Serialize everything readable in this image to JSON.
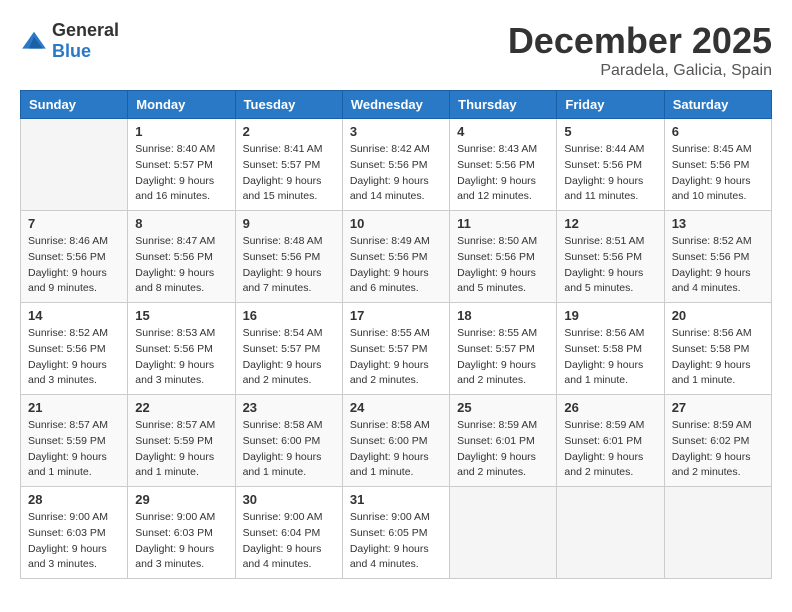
{
  "logo": {
    "general": "General",
    "blue": "Blue"
  },
  "header": {
    "month": "December 2025",
    "location": "Paradela, Galicia, Spain"
  },
  "weekdays": [
    "Sunday",
    "Monday",
    "Tuesday",
    "Wednesday",
    "Thursday",
    "Friday",
    "Saturday"
  ],
  "weeks": [
    [
      {
        "day": "",
        "sunrise": "",
        "sunset": "",
        "daylight": ""
      },
      {
        "day": "1",
        "sunrise": "Sunrise: 8:40 AM",
        "sunset": "Sunset: 5:57 PM",
        "daylight": "Daylight: 9 hours and 16 minutes."
      },
      {
        "day": "2",
        "sunrise": "Sunrise: 8:41 AM",
        "sunset": "Sunset: 5:57 PM",
        "daylight": "Daylight: 9 hours and 15 minutes."
      },
      {
        "day": "3",
        "sunrise": "Sunrise: 8:42 AM",
        "sunset": "Sunset: 5:56 PM",
        "daylight": "Daylight: 9 hours and 14 minutes."
      },
      {
        "day": "4",
        "sunrise": "Sunrise: 8:43 AM",
        "sunset": "Sunset: 5:56 PM",
        "daylight": "Daylight: 9 hours and 12 minutes."
      },
      {
        "day": "5",
        "sunrise": "Sunrise: 8:44 AM",
        "sunset": "Sunset: 5:56 PM",
        "daylight": "Daylight: 9 hours and 11 minutes."
      },
      {
        "day": "6",
        "sunrise": "Sunrise: 8:45 AM",
        "sunset": "Sunset: 5:56 PM",
        "daylight": "Daylight: 9 hours and 10 minutes."
      }
    ],
    [
      {
        "day": "7",
        "sunrise": "Sunrise: 8:46 AM",
        "sunset": "Sunset: 5:56 PM",
        "daylight": "Daylight: 9 hours and 9 minutes."
      },
      {
        "day": "8",
        "sunrise": "Sunrise: 8:47 AM",
        "sunset": "Sunset: 5:56 PM",
        "daylight": "Daylight: 9 hours and 8 minutes."
      },
      {
        "day": "9",
        "sunrise": "Sunrise: 8:48 AM",
        "sunset": "Sunset: 5:56 PM",
        "daylight": "Daylight: 9 hours and 7 minutes."
      },
      {
        "day": "10",
        "sunrise": "Sunrise: 8:49 AM",
        "sunset": "Sunset: 5:56 PM",
        "daylight": "Daylight: 9 hours and 6 minutes."
      },
      {
        "day": "11",
        "sunrise": "Sunrise: 8:50 AM",
        "sunset": "Sunset: 5:56 PM",
        "daylight": "Daylight: 9 hours and 5 minutes."
      },
      {
        "day": "12",
        "sunrise": "Sunrise: 8:51 AM",
        "sunset": "Sunset: 5:56 PM",
        "daylight": "Daylight: 9 hours and 5 minutes."
      },
      {
        "day": "13",
        "sunrise": "Sunrise: 8:52 AM",
        "sunset": "Sunset: 5:56 PM",
        "daylight": "Daylight: 9 hours and 4 minutes."
      }
    ],
    [
      {
        "day": "14",
        "sunrise": "Sunrise: 8:52 AM",
        "sunset": "Sunset: 5:56 PM",
        "daylight": "Daylight: 9 hours and 3 minutes."
      },
      {
        "day": "15",
        "sunrise": "Sunrise: 8:53 AM",
        "sunset": "Sunset: 5:56 PM",
        "daylight": "Daylight: 9 hours and 3 minutes."
      },
      {
        "day": "16",
        "sunrise": "Sunrise: 8:54 AM",
        "sunset": "Sunset: 5:57 PM",
        "daylight": "Daylight: 9 hours and 2 minutes."
      },
      {
        "day": "17",
        "sunrise": "Sunrise: 8:55 AM",
        "sunset": "Sunset: 5:57 PM",
        "daylight": "Daylight: 9 hours and 2 minutes."
      },
      {
        "day": "18",
        "sunrise": "Sunrise: 8:55 AM",
        "sunset": "Sunset: 5:57 PM",
        "daylight": "Daylight: 9 hours and 2 minutes."
      },
      {
        "day": "19",
        "sunrise": "Sunrise: 8:56 AM",
        "sunset": "Sunset: 5:58 PM",
        "daylight": "Daylight: 9 hours and 1 minute."
      },
      {
        "day": "20",
        "sunrise": "Sunrise: 8:56 AM",
        "sunset": "Sunset: 5:58 PM",
        "daylight": "Daylight: 9 hours and 1 minute."
      }
    ],
    [
      {
        "day": "21",
        "sunrise": "Sunrise: 8:57 AM",
        "sunset": "Sunset: 5:59 PM",
        "daylight": "Daylight: 9 hours and 1 minute."
      },
      {
        "day": "22",
        "sunrise": "Sunrise: 8:57 AM",
        "sunset": "Sunset: 5:59 PM",
        "daylight": "Daylight: 9 hours and 1 minute."
      },
      {
        "day": "23",
        "sunrise": "Sunrise: 8:58 AM",
        "sunset": "Sunset: 6:00 PM",
        "daylight": "Daylight: 9 hours and 1 minute."
      },
      {
        "day": "24",
        "sunrise": "Sunrise: 8:58 AM",
        "sunset": "Sunset: 6:00 PM",
        "daylight": "Daylight: 9 hours and 1 minute."
      },
      {
        "day": "25",
        "sunrise": "Sunrise: 8:59 AM",
        "sunset": "Sunset: 6:01 PM",
        "daylight": "Daylight: 9 hours and 2 minutes."
      },
      {
        "day": "26",
        "sunrise": "Sunrise: 8:59 AM",
        "sunset": "Sunset: 6:01 PM",
        "daylight": "Daylight: 9 hours and 2 minutes."
      },
      {
        "day": "27",
        "sunrise": "Sunrise: 8:59 AM",
        "sunset": "Sunset: 6:02 PM",
        "daylight": "Daylight: 9 hours and 2 minutes."
      }
    ],
    [
      {
        "day": "28",
        "sunrise": "Sunrise: 9:00 AM",
        "sunset": "Sunset: 6:03 PM",
        "daylight": "Daylight: 9 hours and 3 minutes."
      },
      {
        "day": "29",
        "sunrise": "Sunrise: 9:00 AM",
        "sunset": "Sunset: 6:03 PM",
        "daylight": "Daylight: 9 hours and 3 minutes."
      },
      {
        "day": "30",
        "sunrise": "Sunrise: 9:00 AM",
        "sunset": "Sunset: 6:04 PM",
        "daylight": "Daylight: 9 hours and 4 minutes."
      },
      {
        "day": "31",
        "sunrise": "Sunrise: 9:00 AM",
        "sunset": "Sunset: 6:05 PM",
        "daylight": "Daylight: 9 hours and 4 minutes."
      },
      {
        "day": "",
        "sunrise": "",
        "sunset": "",
        "daylight": ""
      },
      {
        "day": "",
        "sunrise": "",
        "sunset": "",
        "daylight": ""
      },
      {
        "day": "",
        "sunrise": "",
        "sunset": "",
        "daylight": ""
      }
    ]
  ]
}
